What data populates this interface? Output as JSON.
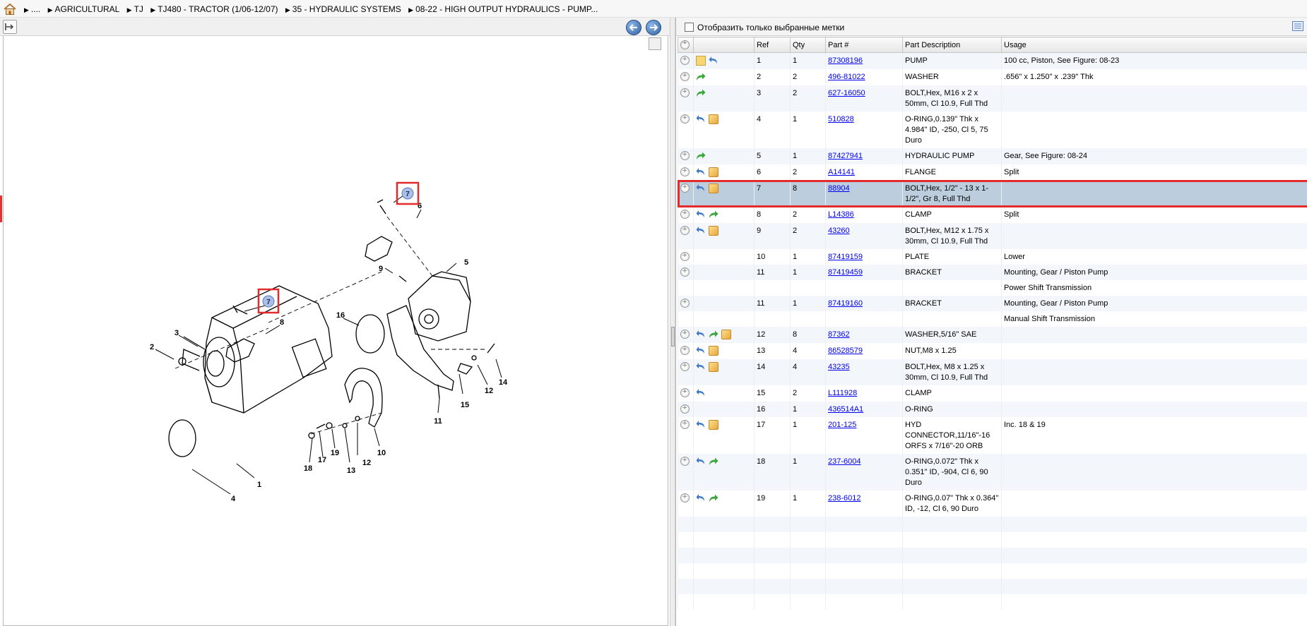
{
  "breadcrumb": [
    "....",
    "AGRICULTURAL",
    "TJ",
    "TJ480 - TRACTOR (1/06-12/07)",
    "35 - HYDRAULIC SYSTEMS",
    "08-22 - HIGH OUTPUT HYDRAULICS - PUMP..."
  ],
  "filter": {
    "label": "Отобразить только выбранные метки"
  },
  "table": {
    "headers": {
      "ref": "Ref",
      "qty": "Qty",
      "part": "Part #",
      "desc": "Part Description",
      "usage": "Usage"
    }
  },
  "rows": [
    {
      "ref": "1",
      "qty": "1",
      "part": "87308196",
      "desc": "PUMP",
      "usage": "100 cc, Piston, See Figure: 08-23",
      "icons": [
        "add-icon",
        "note-icon",
        "return-arrow-icon"
      ]
    },
    {
      "ref": "2",
      "qty": "2",
      "part": "496-81022",
      "desc": "WASHER",
      "usage": ".656\" x 1.250\" x .239\" Thk",
      "icons": [
        "add-icon",
        "forward-arrow-icon"
      ]
    },
    {
      "ref": "3",
      "qty": "2",
      "part": "627-16050",
      "desc": "BOLT,Hex, M16 x 2 x 50mm, Cl 10.9, Full Thd",
      "usage": "",
      "icons": [
        "add-icon",
        "forward-arrow-icon"
      ]
    },
    {
      "ref": "4",
      "qty": "1",
      "part": "510828",
      "desc": "O-RING,0.139\" Thk x 4.984\" ID, -250, Cl 5, 75 Duro",
      "usage": "",
      "icons": [
        "add-icon",
        "return-arrow-icon",
        "box-icon"
      ]
    },
    {
      "ref": "5",
      "qty": "1",
      "part": "87427941",
      "desc": "HYDRAULIC PUMP",
      "usage": "Gear, See Figure: 08-24",
      "icons": [
        "add-icon",
        "forward-arrow-icon"
      ]
    },
    {
      "ref": "6",
      "qty": "2",
      "part": "A14141",
      "desc": "FLANGE",
      "usage": "Split",
      "icons": [
        "add-icon",
        "return-arrow-icon",
        "box-icon"
      ]
    },
    {
      "ref": "7",
      "qty": "8",
      "part": "88904",
      "desc": "BOLT,Hex, 1/2\" - 13 x 1-1/2\", Gr 8, Full Thd",
      "usage": "",
      "icons": [
        "add-icon",
        "return-arrow-icon",
        "box-icon"
      ]
    },
    {
      "ref": "8",
      "qty": "2",
      "part": "L14386",
      "desc": "CLAMP",
      "usage": "Split",
      "icons": [
        "add-icon",
        "return-arrow-icon",
        "forward-arrow-icon"
      ]
    },
    {
      "ref": "9",
      "qty": "2",
      "part": "43260",
      "desc": "BOLT,Hex, M12 x 1.75 x 30mm, Cl 10.9, Full Thd",
      "usage": "",
      "icons": [
        "add-icon",
        "return-arrow-icon",
        "box-icon"
      ]
    },
    {
      "ref": "10",
      "qty": "1",
      "part": "87419159",
      "desc": "PLATE",
      "usage": "Lower",
      "icons": [
        "add-icon"
      ]
    },
    {
      "ref": "11",
      "qty": "1",
      "part": "87419459",
      "desc": "BRACKET",
      "usage": "Mounting, Gear / Piston Pump",
      "icons": [
        "add-icon"
      ]
    },
    {
      "ref": "",
      "qty": "",
      "part": "",
      "desc": "",
      "usage": "Power Shift  Transmission",
      "icons": []
    },
    {
      "ref": "11",
      "qty": "1",
      "part": "87419160",
      "desc": "BRACKET",
      "usage": "Mounting, Gear / Piston Pump",
      "icons": [
        "add-icon"
      ]
    },
    {
      "ref": "",
      "qty": "",
      "part": "",
      "desc": "",
      "usage": "Manual Shift Transmission",
      "icons": []
    },
    {
      "ref": "12",
      "qty": "8",
      "part": "87362",
      "desc": "WASHER,5/16\" SAE",
      "usage": "",
      "icons": [
        "add-icon",
        "return-arrow-icon",
        "forward-arrow-icon",
        "box-icon"
      ]
    },
    {
      "ref": "13",
      "qty": "4",
      "part": "86528579",
      "desc": "NUT,M8 x 1.25",
      "usage": "",
      "icons": [
        "add-icon",
        "return-arrow-icon",
        "box-icon"
      ]
    },
    {
      "ref": "14",
      "qty": "4",
      "part": "43235",
      "desc": "BOLT,Hex, M8 x 1.25 x 30mm, Cl 10.9, Full Thd",
      "usage": "",
      "icons": [
        "add-icon",
        "return-arrow-icon",
        "box-icon"
      ]
    },
    {
      "ref": "15",
      "qty": "2",
      "part": "L111928",
      "desc": "CLAMP",
      "usage": "",
      "icons": [
        "add-icon",
        "return-arrow-icon"
      ]
    },
    {
      "ref": "16",
      "qty": "1",
      "part": "436514A1",
      "desc": "O-RING",
      "usage": "",
      "icons": [
        "add-icon"
      ]
    },
    {
      "ref": "17",
      "qty": "1",
      "part": "201-125",
      "desc": "HYD CONNECTOR,11/16\"-16 ORFS x 7/16\"-20 ORB",
      "usage": "Inc. 18 & 19",
      "icons": [
        "add-icon",
        "return-arrow-icon",
        "box-icon"
      ]
    },
    {
      "ref": "18",
      "qty": "1",
      "part": "237-6004",
      "desc": "O-RING,0.072\" Thk x 0.351\" ID, -904, Cl 6, 90 Duro",
      "usage": "",
      "icons": [
        "add-icon",
        "return-arrow-icon",
        "forward-arrow-icon"
      ]
    },
    {
      "ref": "19",
      "qty": "1",
      "part": "238-6012",
      "desc": "O-RING,0.07\" Thk x 0.364\" ID, -12, Cl 6, 90 Duro",
      "usage": "",
      "icons": [
        "add-icon",
        "return-arrow-icon",
        "forward-arrow-icon"
      ]
    }
  ],
  "selected_ref": "7",
  "diagram_labels": [
    "7",
    "6",
    "9",
    "5",
    "7",
    "8",
    "3",
    "2",
    "16",
    "14",
    "12",
    "15",
    "11",
    "19",
    "12",
    "10",
    "17",
    "18",
    "13",
    "1",
    "4"
  ],
  "colors": {
    "selected_row": "#bccede",
    "highlight_border": "#e42b2b",
    "link": "#0000ee",
    "callout_fill": "#a9bfe8"
  }
}
